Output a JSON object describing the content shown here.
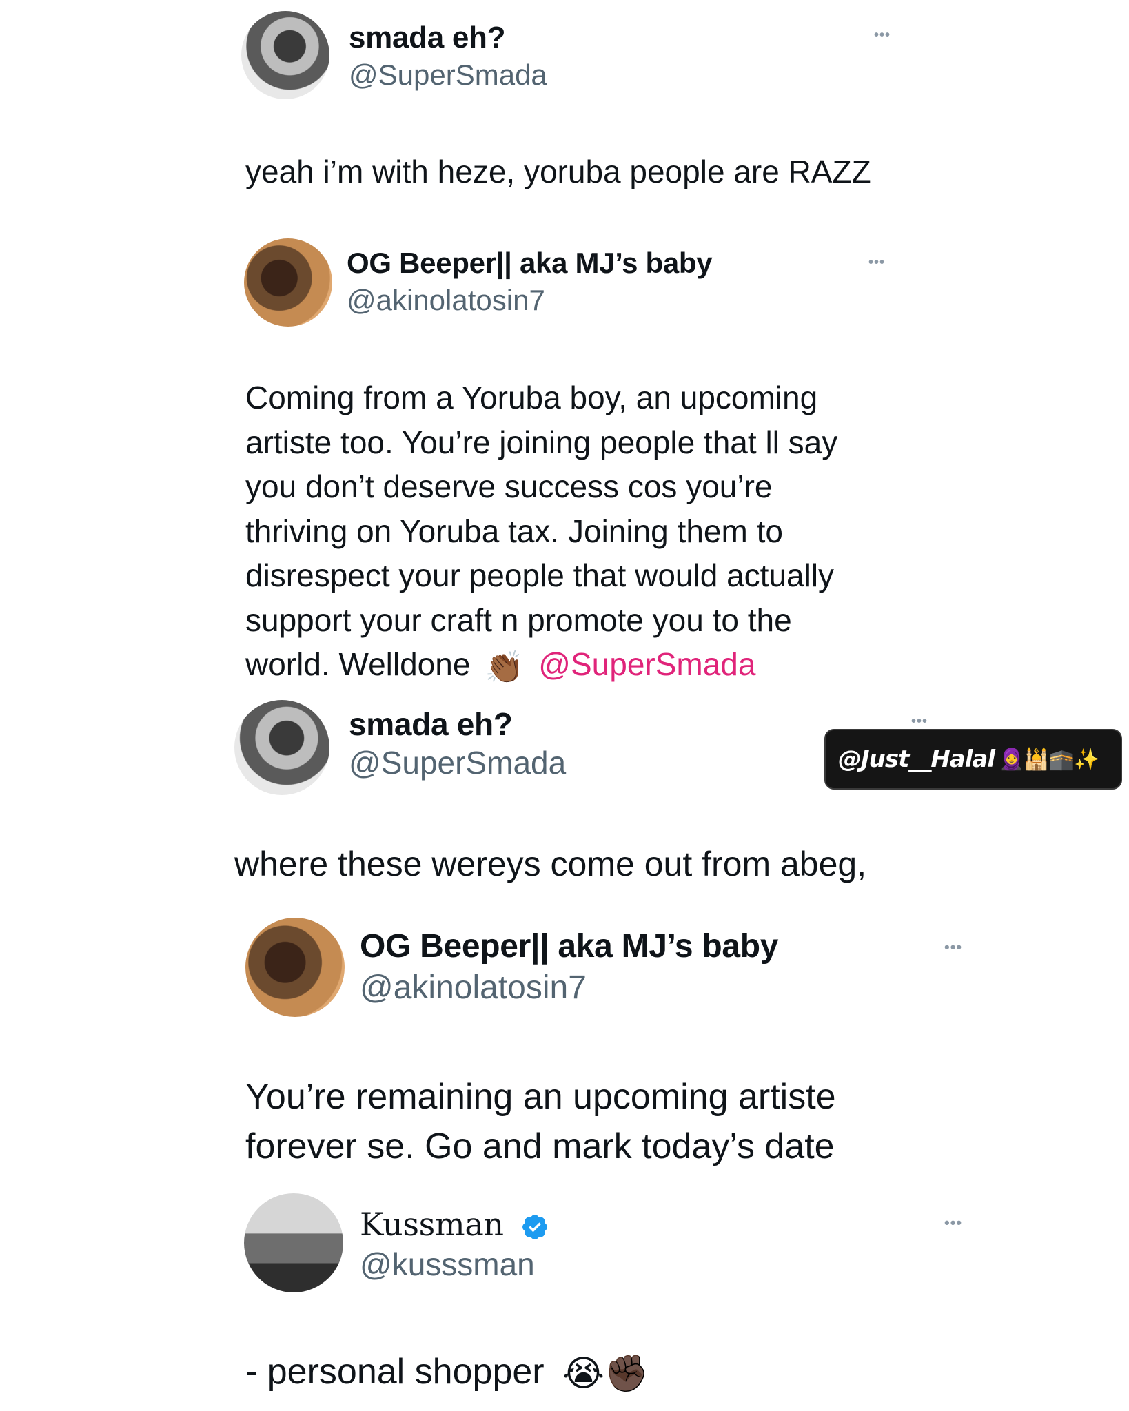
{
  "tweets": [
    {
      "name": "smada eh?",
      "handle": "@SuperSmada",
      "more": "•••",
      "text": "yeah i’m with heze, yoruba people are RAZZ"
    },
    {
      "name": "OG Beeper|| aka MJ’s baby",
      "handle": "@akinolatosin7",
      "more": "•••",
      "text_lines": [
        "Coming from a Yoruba boy, an upcoming",
        "artiste too. You’re joining people that ll say",
        "you don’t deserve success cos you’re",
        "thriving on Yoruba tax. Joining them to",
        "disrespect your people that would actually",
        "support your craft n promote you to the"
      ],
      "last_line": "world. Welldone",
      "emoji": "👏🏾",
      "mention": "@SuperSmada"
    },
    {
      "name": "smada eh?",
      "handle": "@SuperSmada",
      "more": "•••",
      "text": "where these wereys come out from abeg,"
    },
    {
      "name": "OG Beeper|| aka MJ’s baby",
      "handle": "@akinolatosin7",
      "more": "•••",
      "text_lines": [
        "You’re remaining an upcoming artiste",
        "forever se. Go and mark today’s date"
      ]
    },
    {
      "name": "Kussman",
      "handle": "@kusssman",
      "more": "•••",
      "verified": true,
      "text": "- personal shopper",
      "emojis": "😭✊🏿"
    }
  ],
  "watermark": {
    "text": "@Just__Halal",
    "emojis": "🧕🕌🕋✨"
  },
  "colors": {
    "mention": "#e0247a",
    "handle": "#536471",
    "verified": "#1d9bf0",
    "watermark_bg": "#151515"
  }
}
